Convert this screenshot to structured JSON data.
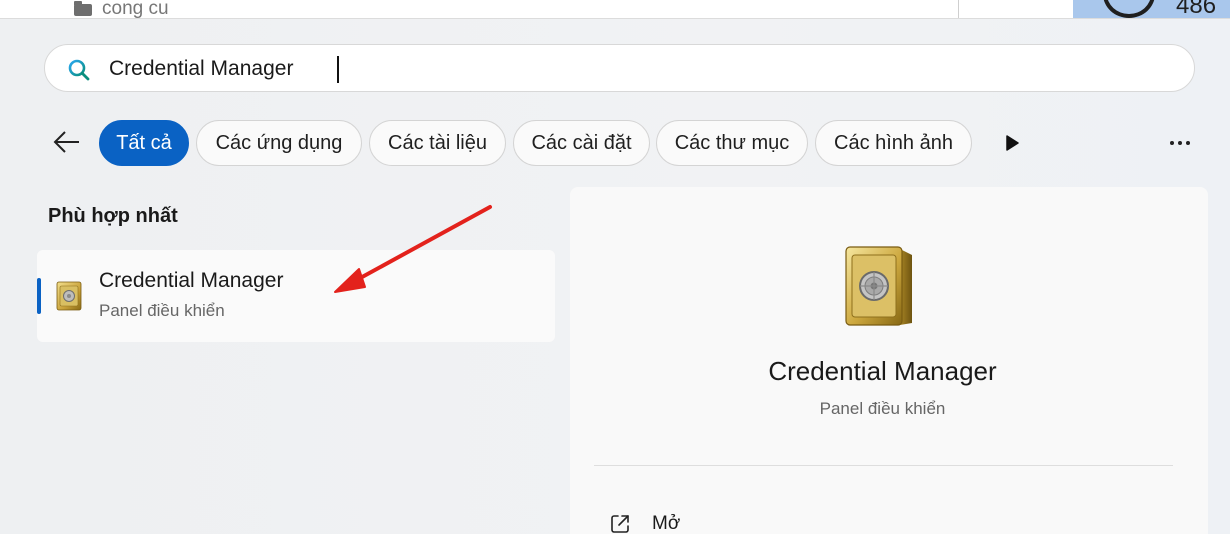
{
  "background": {
    "folder_label": "cong cu",
    "badge_number": "486"
  },
  "search": {
    "value": "Credential Manager",
    "icon": "search-icon"
  },
  "filters": {
    "items": [
      {
        "label": "Tất cả",
        "active": true
      },
      {
        "label": "Các ứng dụng",
        "active": false
      },
      {
        "label": "Các tài liệu",
        "active": false
      },
      {
        "label": "Các cài đặt",
        "active": false
      },
      {
        "label": "Các thư mục",
        "active": false
      },
      {
        "label": "Các hình ảnh",
        "active": false
      }
    ]
  },
  "results": {
    "section_title": "Phù hợp nhất",
    "best_match": {
      "name": "Credential Manager",
      "subtitle": "Panel điều khiển",
      "icon": "safe-icon"
    }
  },
  "detail": {
    "name": "Credential Manager",
    "subtitle": "Panel điều khiển",
    "icon": "safe-icon",
    "actions": [
      {
        "label": "Mở",
        "icon": "open-external-icon"
      }
    ]
  },
  "colors": {
    "accent": "#0a62c4",
    "annotation_arrow": "#e3221c"
  }
}
